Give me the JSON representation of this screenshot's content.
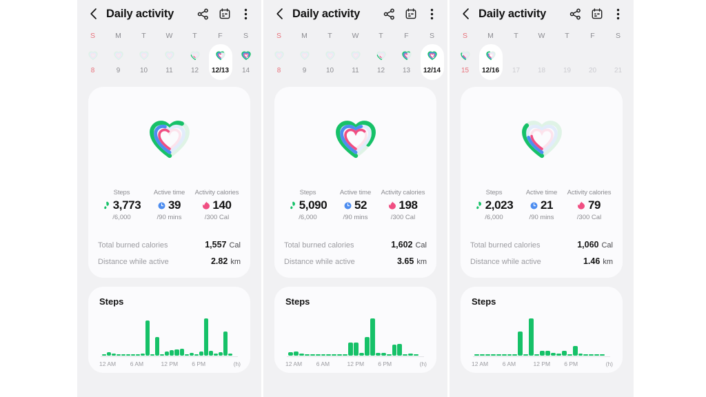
{
  "app": {
    "title": "Daily activity",
    "back_icon": "chevron-left-icon",
    "share_icon": "share-icon",
    "calendar_icon": "calendar-icon",
    "overflow_icon": "more-vertical-icon"
  },
  "colors": {
    "steps": "#16c168",
    "active_time": "#4d8df0",
    "calories": "#f04e82",
    "panel_bg": "#f1f1f3",
    "card_bg": "#fbfbfd",
    "sunday": "#e8707a",
    "muted": "#8b8b90",
    "future": "#cbcbd0"
  },
  "labels": {
    "steps": "Steps",
    "active_time": "Active time",
    "activity_calories": "Activity calories",
    "total_burned": "Total burned calories",
    "distance": "Distance while active",
    "steps_chart_title": "Steps",
    "hour_unit": "(h)",
    "cal_unit": "Cal",
    "km_unit": "km"
  },
  "weekday_headers": [
    "S",
    "M",
    "T",
    "W",
    "T",
    "F",
    "S"
  ],
  "x_ticks": [
    "12 AM",
    "6 AM",
    "12 PM",
    "6 PM"
  ],
  "panels": [
    {
      "id": "panel-12-13",
      "days": [
        {
          "label": "8",
          "state": "sunday",
          "fill": 0.1
        },
        {
          "label": "9",
          "state": "normal",
          "fill": 0.1
        },
        {
          "label": "10",
          "state": "normal",
          "fill": 0.1
        },
        {
          "label": "11",
          "state": "normal",
          "fill": 0.1
        },
        {
          "label": "12",
          "state": "normal",
          "fill": 0.22
        },
        {
          "label": "12/13",
          "state": "selected",
          "fill": 0.62
        },
        {
          "label": "14",
          "state": "normal",
          "fill": 0.95
        }
      ],
      "rings": {
        "steps": 0.63,
        "active_time": 0.43,
        "calories": 0.47
      },
      "metrics": {
        "steps": {
          "value": "3,773",
          "goal": "/6,000",
          "icon": "steps-icon"
        },
        "active_time": {
          "value": "39",
          "goal": "/90 mins",
          "icon": "clock-icon"
        },
        "activity_calories": {
          "value": "140",
          "goal": "/300 Cal",
          "icon": "flame-icon"
        }
      },
      "summary": {
        "total_burned_calories": "1,557",
        "distance_while_active": "2.82"
      },
      "chart_data": {
        "type": "bar",
        "title": "Steps",
        "xlabel": "(h)",
        "ylabel": "",
        "xticks": [
          "12 AM",
          "6 AM",
          "12 PM",
          "6 PM"
        ],
        "categories": [
          "0",
          "1",
          "2",
          "3",
          "4",
          "5",
          "6",
          "7",
          "8",
          "9",
          "10",
          "11",
          "12",
          "13",
          "14",
          "15",
          "16",
          "17",
          "18",
          "19",
          "20",
          "21",
          "22",
          "23"
        ],
        "values": [
          0,
          40,
          12,
          0,
          0,
          0,
          0,
          0,
          30,
          440,
          0,
          230,
          0,
          55,
          70,
          78,
          88,
          0,
          35,
          0,
          48,
          470,
          62,
          30,
          42,
          300,
          24
        ],
        "ylim": [
          0,
          500
        ]
      }
    },
    {
      "id": "panel-12-14",
      "days": [
        {
          "label": "8",
          "state": "sunday",
          "fill": 0.1
        },
        {
          "label": "9",
          "state": "normal",
          "fill": 0.1
        },
        {
          "label": "10",
          "state": "normal",
          "fill": 0.1
        },
        {
          "label": "11",
          "state": "normal",
          "fill": 0.1
        },
        {
          "label": "12",
          "state": "normal",
          "fill": 0.22
        },
        {
          "label": "13",
          "state": "normal",
          "fill": 0.62
        },
        {
          "label": "12/14",
          "state": "selected",
          "fill": 0.95
        }
      ],
      "rings": {
        "steps": 0.85,
        "active_time": 0.58,
        "calories": 0.66
      },
      "metrics": {
        "steps": {
          "value": "5,090",
          "goal": "/6,000",
          "icon": "steps-icon"
        },
        "active_time": {
          "value": "52",
          "goal": "/90 mins",
          "icon": "clock-icon"
        },
        "activity_calories": {
          "value": "198",
          "goal": "/300 Cal",
          "icon": "flame-icon"
        }
      },
      "summary": {
        "total_burned_calories": "1,602",
        "distance_while_active": "3.65"
      },
      "chart_data": {
        "type": "bar",
        "title": "Steps",
        "xlabel": "(h)",
        "ylabel": "",
        "xticks": [
          "12 AM",
          "6 AM",
          "12 PM",
          "6 PM"
        ],
        "categories": [
          "0",
          "1",
          "2",
          "3",
          "4",
          "5",
          "6",
          "7",
          "8",
          "9",
          "10",
          "11",
          "12",
          "13",
          "14",
          "15",
          "16",
          "17",
          "18",
          "19",
          "20",
          "21",
          "22",
          "23"
        ],
        "values": [
          38,
          42,
          12,
          0,
          0,
          0,
          0,
          0,
          0,
          0,
          0,
          138,
          135,
          30,
          195,
          395,
          30,
          28,
          0,
          118,
          122,
          0,
          22,
          0
        ],
        "ylim": [
          0,
          420
        ]
      }
    },
    {
      "id": "panel-12-16",
      "days": [
        {
          "label": "15",
          "state": "sunday",
          "fill": 0.3
        },
        {
          "label": "12/16",
          "state": "selected",
          "fill": 0.42
        },
        {
          "label": "17",
          "state": "future",
          "fill": 0
        },
        {
          "label": "18",
          "state": "future",
          "fill": 0
        },
        {
          "label": "19",
          "state": "future",
          "fill": 0
        },
        {
          "label": "20",
          "state": "future",
          "fill": 0
        },
        {
          "label": "21",
          "state": "future",
          "fill": 0
        }
      ],
      "rings": {
        "steps": 0.34,
        "active_time": 0.23,
        "calories": 0.26
      },
      "metrics": {
        "steps": {
          "value": "2,023",
          "goal": "/6,000",
          "icon": "steps-icon"
        },
        "active_time": {
          "value": "21",
          "goal": "/90 mins",
          "icon": "clock-icon"
        },
        "activity_calories": {
          "value": "79",
          "goal": "/300 Cal",
          "icon": "flame-icon"
        }
      },
      "summary": {
        "total_burned_calories": "1,060",
        "distance_while_active": "1.46"
      },
      "chart_data": {
        "type": "bar",
        "title": "Steps",
        "xlabel": "(h)",
        "ylabel": "",
        "xticks": [
          "12 AM",
          "6 AM",
          "12 PM",
          "6 PM"
        ],
        "categories": [
          "0",
          "1",
          "2",
          "3",
          "4",
          "5",
          "6",
          "7",
          "8",
          "9",
          "10",
          "11",
          "12",
          "13",
          "14",
          "15",
          "16",
          "17",
          "18",
          "19",
          "20",
          "21",
          "22",
          "23"
        ],
        "values": [
          0,
          0,
          0,
          0,
          0,
          0,
          0,
          0,
          225,
          0,
          345,
          0,
          45,
          42,
          28,
          22,
          48,
          0,
          92,
          20,
          0,
          0,
          0,
          0
        ],
        "ylim": [
          0,
          370
        ]
      }
    }
  ]
}
